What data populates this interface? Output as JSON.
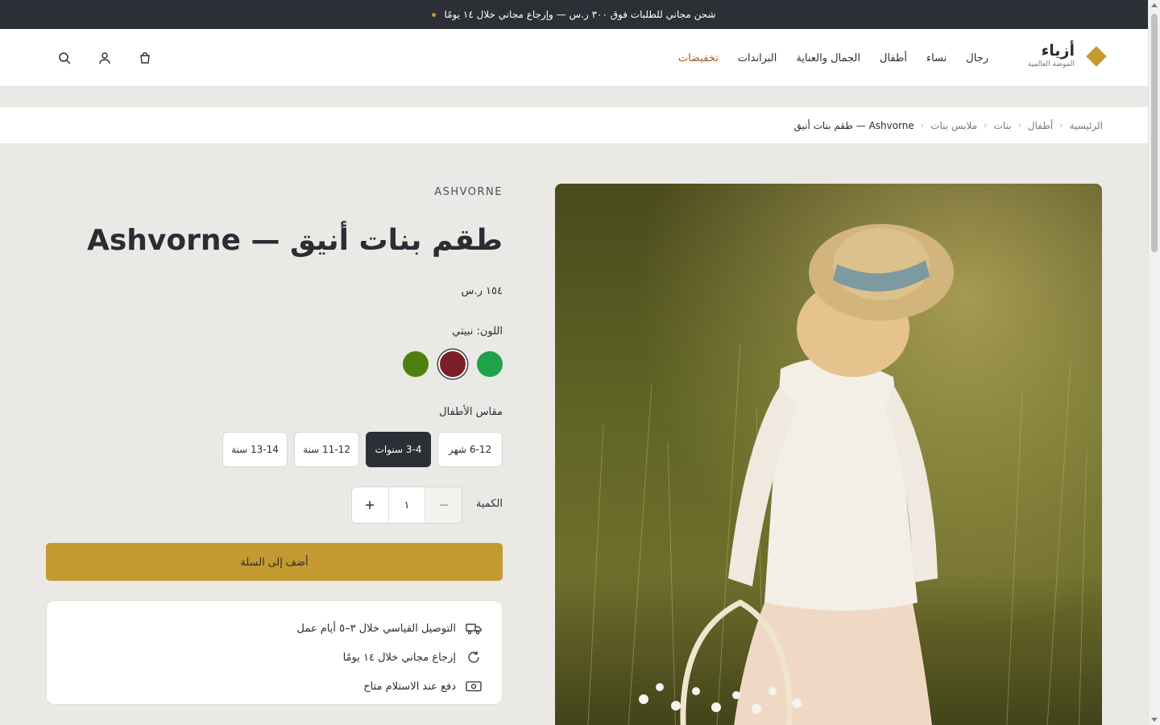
{
  "announcement": {
    "text": "شحن مجاني للطلبات فوق ٣٠٠ ر.س — وإرجاع مجاني خلال ١٤ يومًا"
  },
  "header": {
    "logo_name": "أزياء",
    "logo_sub": "الموضة العالمية",
    "nav": [
      "رجال",
      "نساء",
      "أطفال",
      "الجمال والعناية",
      "البراندات",
      "تخفيضات"
    ],
    "icons": [
      "search-icon",
      "user-icon",
      "bag-icon"
    ]
  },
  "breadcrumb": [
    "الرئيسية",
    "أطفال",
    "بنات",
    "ملابس بنات",
    "Ashvorne — طقم بنات أنيق"
  ],
  "breadcrumb_sep": "‹",
  "product": {
    "brand": "ASHVORNE",
    "title": "طقم بنات أنيق — Ashvorne",
    "price": "١٥٤ ر.س",
    "color_label": "اللون: نبيتي",
    "colors": [
      "#1fa34a",
      "#7b1f26",
      "#4f7f10"
    ],
    "selected_color_index": 1,
    "size_label": "مقاس الأطفال",
    "sizes": [
      "6-12 شهر",
      "3-4 سنوات",
      "11-12 سنة",
      "13-14 سنة"
    ],
    "selected_size_index": 1,
    "qty_label": "الكمية",
    "qty_value": "١",
    "add_to_cart": "أضف إلى السلة"
  },
  "features": [
    {
      "icon": "truck-icon",
      "text": "التوصيل القياسي خلال ٣–٥ أيام عمل"
    },
    {
      "icon": "return-icon",
      "text": "إرجاع مجاني خلال ١٤ يومًا"
    },
    {
      "icon": "cash-icon",
      "text": "دفع عند الاستلام متاح"
    }
  ],
  "colors": {
    "accent": "#c39a2f",
    "dark": "#2c2f35",
    "sale": "#9a5b2a"
  }
}
